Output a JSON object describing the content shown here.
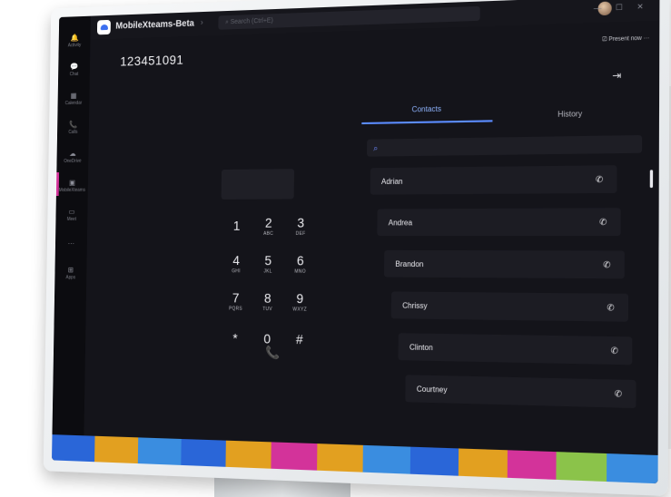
{
  "app": {
    "name": "MobileXteams-Beta",
    "search_placeholder": "Search (Ctrl+E)",
    "nav_arrows": "‹ ›",
    "window_controls": "— ☐ ✕",
    "present_now": "Present now"
  },
  "rail": [
    {
      "icon": "activity-icon",
      "glyph": "🔔",
      "label": "Activity"
    },
    {
      "icon": "chat-icon",
      "glyph": "💬",
      "label": "Chat"
    },
    {
      "icon": "calendar-icon",
      "glyph": "▦",
      "label": "Calendar"
    },
    {
      "icon": "calls-icon",
      "glyph": "📞",
      "label": "Calls"
    },
    {
      "icon": "onedrive-icon",
      "glyph": "☁",
      "label": "OneDrive"
    },
    {
      "icon": "mobilexteams-icon",
      "glyph": "▣",
      "label": "MobileXteams"
    },
    {
      "icon": "meet-icon",
      "glyph": "▭",
      "label": "Meet"
    },
    {
      "icon": "more-icon",
      "glyph": "···",
      "label": ""
    },
    {
      "icon": "apps-icon",
      "glyph": "⊞",
      "label": "Apps"
    }
  ],
  "dialer": {
    "number": "123451091",
    "keys": [
      {
        "digit": "1",
        "letters": ""
      },
      {
        "digit": "2",
        "letters": "ABC"
      },
      {
        "digit": "3",
        "letters": "DEF"
      },
      {
        "digit": "4",
        "letters": "GHI"
      },
      {
        "digit": "5",
        "letters": "JKL"
      },
      {
        "digit": "6",
        "letters": "MNO"
      },
      {
        "digit": "7",
        "letters": "PQRS"
      },
      {
        "digit": "8",
        "letters": "TUV"
      },
      {
        "digit": "9",
        "letters": "WXYZ"
      },
      {
        "digit": "*",
        "letters": ""
      },
      {
        "digit": "0",
        "letters": ""
      },
      {
        "digit": "#",
        "letters": ""
      }
    ],
    "call_glyph": "📞"
  },
  "tabs": {
    "contacts": "Contacts",
    "history": "History"
  },
  "contacts": [
    {
      "name": "Adrian"
    },
    {
      "name": "Andrea"
    },
    {
      "name": "Brandon"
    },
    {
      "name": "Chrissy"
    },
    {
      "name": "Clinton"
    },
    {
      "name": "Courtney"
    }
  ],
  "icons": {
    "search": "search-icon",
    "exit": "exit-icon",
    "phone": "phone-icon"
  },
  "colors": {
    "accent": "#5b8cff",
    "call_green": "#3bd27a",
    "rail_highlight": "#d3339a",
    "taskbar": [
      "#2a66d8",
      "#e2a020",
      "#3a8de0",
      "#2a66d8",
      "#e2a020",
      "#d3339a",
      "#e2a020",
      "#3a8de0",
      "#2a66d8",
      "#e2a020",
      "#d3339a",
      "#8bc34a",
      "#3a8de0"
    ]
  }
}
